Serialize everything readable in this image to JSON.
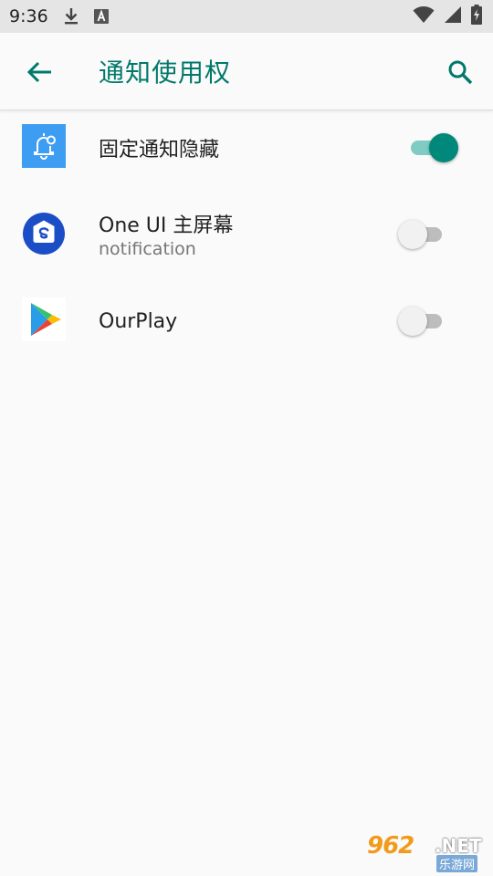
{
  "status_bar": {
    "time": "9:36",
    "icons": [
      "download-icon",
      "text-a-icon",
      "wifi-icon",
      "cell-signal-icon",
      "battery-charging-icon"
    ]
  },
  "app_bar": {
    "title": "通知使用权",
    "back_icon": "arrow-back-icon",
    "search_icon": "search-icon",
    "accent_color": "#00796b"
  },
  "apps": [
    {
      "name": "固定通知隐藏",
      "subtitle": "",
      "icon": "bell-settings-icon",
      "enabled": true
    },
    {
      "name": "One UI 主屏幕",
      "subtitle": "notification",
      "icon": "samsung-home-icon",
      "enabled": false
    },
    {
      "name": "OurPlay",
      "subtitle": "",
      "icon": "play-triangle-icon",
      "enabled": false
    }
  ],
  "watermark": {
    "number": "962",
    "suffix": ".NET",
    "caption": "乐游网"
  },
  "colors": {
    "switch_on_thumb": "#00897b",
    "switch_on_track": "#80cbc4",
    "switch_off_thumb": "#f1f1f1",
    "switch_off_track": "#bdbdbd"
  }
}
